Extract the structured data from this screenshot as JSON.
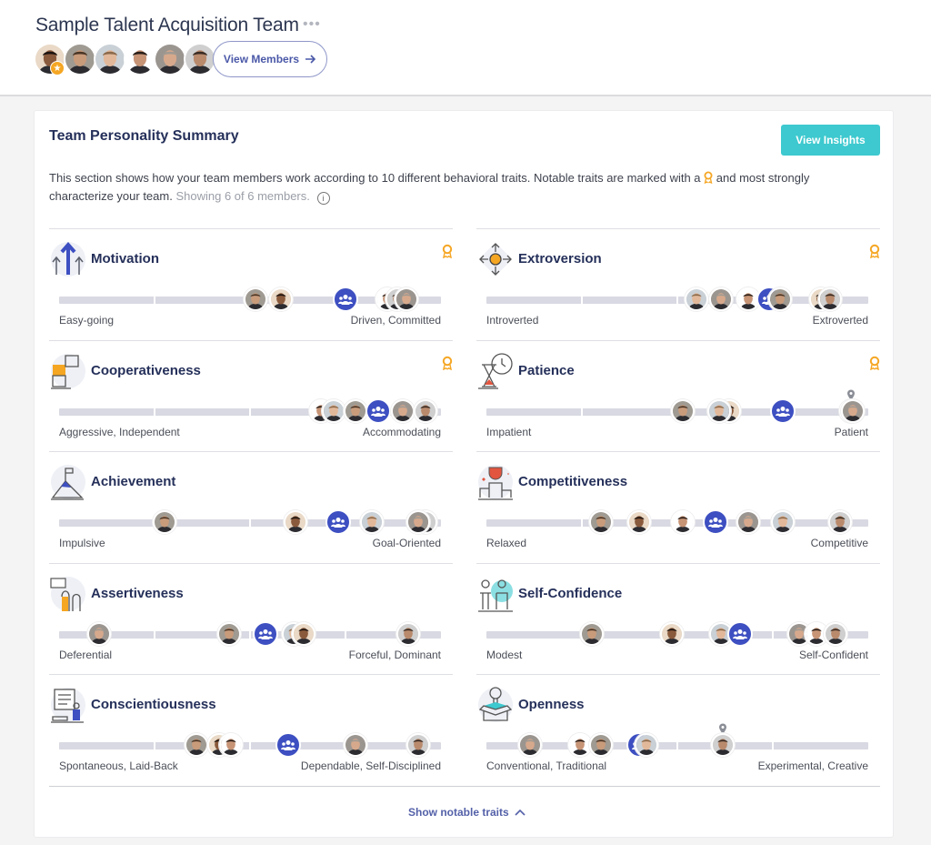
{
  "header": {
    "team_title": "Sample Talent Acquisition Team",
    "more_icon": "more-dots-icon",
    "view_members_label": "View Members",
    "members": [
      {
        "name": "member-1",
        "skin": "#8a5a3c",
        "hair": "#1d1410",
        "bg": "#e9d9c6",
        "leader": true
      },
      {
        "name": "member-2",
        "skin": "#c89b7b",
        "hair": "#4a3626",
        "bg": "#9f9a92",
        "leader": false
      },
      {
        "name": "member-3",
        "skin": "#e2b89a",
        "hair": "#8b6a4b",
        "bg": "#c9d0d6",
        "leader": false
      },
      {
        "name": "member-4",
        "skin": "#c79476",
        "hair": "#2a1e18",
        "bg": "#ffffff",
        "leader": false
      },
      {
        "name": "member-5",
        "skin": "#d7a98c",
        "hair": "#a09a92",
        "bg": "#9b9590",
        "leader": false
      },
      {
        "name": "member-6",
        "skin": "#b98a6c",
        "hair": "#3a2c24",
        "bg": "#cfcfcf",
        "leader": false
      }
    ]
  },
  "summary": {
    "title": "Team Personality Summary",
    "view_insights_label": "View Insights",
    "description_1": "This section shows how your team members work according to 10 different behavioral traits. Notable traits are marked with a",
    "description_2": "and most strongly characterize your team.",
    "showing_text": "Showing 6 of 6 members.",
    "show_notable_label": "Show notable traits",
    "colors": {
      "accent": "#3d4fc1",
      "insights": "#3dc9cf",
      "medal": "#f5a623",
      "track": "#d8d9e2"
    }
  },
  "traits": [
    {
      "name": "Motivation",
      "icon": "arrows-up-icon",
      "left": "Easy-going",
      "right": "Driven, Committed",
      "notable": true,
      "members": [
        {
          "m": 1,
          "pos": 0.515
        },
        {
          "m": 0,
          "pos": 0.58
        },
        {
          "m": 3,
          "pos": 0.86
        },
        {
          "m": 5,
          "pos": 0.885
        },
        {
          "m": 4,
          "pos": 0.91
        }
      ],
      "team": 0.75,
      "pin": null
    },
    {
      "name": "Extroversion",
      "icon": "arrows-out-person-icon",
      "left": "Introverted",
      "right": "Extroverted",
      "notable": true,
      "members": [
        {
          "m": 2,
          "pos": 0.55
        },
        {
          "m": 4,
          "pos": 0.615
        },
        {
          "m": 3,
          "pos": 0.685
        },
        {
          "m": 1,
          "pos": 0.77
        },
        {
          "m": 0,
          "pos": 0.875
        },
        {
          "m": 5,
          "pos": 0.9
        }
      ],
      "team": 0.74,
      "pin": null
    },
    {
      "name": "Cooperativeness",
      "icon": "puzzle-icon",
      "left": "Aggressive, Independent",
      "right": "Accommodating",
      "notable": true,
      "members": [
        {
          "m": 3,
          "pos": 0.685
        },
        {
          "m": 2,
          "pos": 0.72
        },
        {
          "m": 1,
          "pos": 0.775
        },
        {
          "m": 4,
          "pos": 0.9
        },
        {
          "m": 5,
          "pos": 0.96
        }
      ],
      "team": 0.835,
      "pin": null
    },
    {
      "name": "Patience",
      "icon": "hourglass-clock-icon",
      "left": "Impatient",
      "right": "Patient",
      "notable": true,
      "members": [
        {
          "m": 1,
          "pos": 0.515
        },
        {
          "m": 0,
          "pos": 0.635
        },
        {
          "m": 2,
          "pos": 0.61
        },
        {
          "m": 5,
          "pos": 0.955
        },
        {
          "m": 4,
          "pos": 0.96
        }
      ],
      "team": 0.775,
      "pin": 0.955
    },
    {
      "name": "Achievement",
      "icon": "mountain-flag-icon",
      "left": "Impulsive",
      "right": "Goal-Oriented",
      "notable": false,
      "members": [
        {
          "m": 1,
          "pos": 0.275
        },
        {
          "m": 0,
          "pos": 0.62
        },
        {
          "m": 2,
          "pos": 0.82
        },
        {
          "m": 5,
          "pos": 0.96
        },
        {
          "m": 4,
          "pos": 0.94
        }
      ],
      "team": 0.73,
      "pin": null
    },
    {
      "name": "Competitiveness",
      "icon": "trophy-podium-icon",
      "left": "Relaxed",
      "right": "Competitive",
      "notable": false,
      "members": [
        {
          "m": 1,
          "pos": 0.3
        },
        {
          "m": 0,
          "pos": 0.4
        },
        {
          "m": 3,
          "pos": 0.515
        },
        {
          "m": 4,
          "pos": 0.685
        },
        {
          "m": 2,
          "pos": 0.775
        },
        {
          "m": 5,
          "pos": 0.925
        }
      ],
      "team": 0.6,
      "pin": null
    },
    {
      "name": "Assertiveness",
      "icon": "raised-hands-icon",
      "left": "Deferential",
      "right": "Forceful, Dominant",
      "notable": false,
      "members": [
        {
          "m": 4,
          "pos": 0.105
        },
        {
          "m": 1,
          "pos": 0.445
        },
        {
          "m": 2,
          "pos": 0.615
        },
        {
          "m": 0,
          "pos": 0.64
        },
        {
          "m": 5,
          "pos": 0.915
        }
      ],
      "team": 0.54,
      "pin": null
    },
    {
      "name": "Self-Confidence",
      "icon": "confident-person-icon",
      "left": "Modest",
      "right": "Self-Confident",
      "notable": false,
      "members": [
        {
          "m": 1,
          "pos": 0.275
        },
        {
          "m": 0,
          "pos": 0.485
        },
        {
          "m": 2,
          "pos": 0.615
        },
        {
          "m": 4,
          "pos": 0.82
        },
        {
          "m": 3,
          "pos": 0.865
        },
        {
          "m": 5,
          "pos": 0.915
        }
      ],
      "team": 0.665,
      "pin": null
    },
    {
      "name": "Conscientiousness",
      "icon": "checklist-person-icon",
      "left": "Spontaneous, Laid-Back",
      "right": "Dependable, Self-Disciplined",
      "notable": false,
      "members": [
        {
          "m": 1,
          "pos": 0.36
        },
        {
          "m": 0,
          "pos": 0.42
        },
        {
          "m": 3,
          "pos": 0.45
        },
        {
          "m": 4,
          "pos": 0.775
        },
        {
          "m": 5,
          "pos": 0.94
        }
      ],
      "team": 0.6,
      "pin": null
    },
    {
      "name": "Openness",
      "icon": "lightbulb-box-icon",
      "left": "Conventional, Traditional",
      "right": "Experimental, Creative",
      "notable": false,
      "members": [
        {
          "m": 4,
          "pos": 0.115
        },
        {
          "m": 3,
          "pos": 0.245
        },
        {
          "m": 1,
          "pos": 0.3
        },
        {
          "m": 2,
          "pos": 0.42
        },
        {
          "m": 5,
          "pos": 0.62
        }
      ],
      "team": 0.4,
      "pin": 0.62
    }
  ]
}
